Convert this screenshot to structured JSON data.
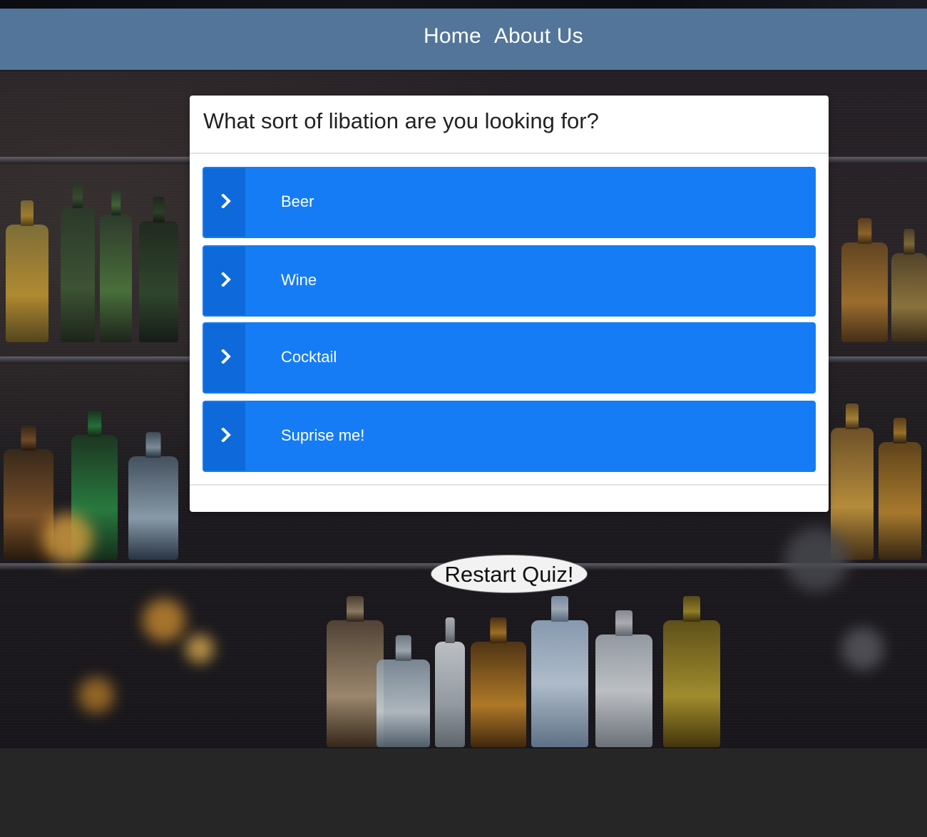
{
  "nav": {
    "links": [
      {
        "label": "Home"
      },
      {
        "label": "About Us"
      }
    ]
  },
  "quiz": {
    "question": "What sort of libation are you looking for?",
    "answers": [
      {
        "label": "Beer",
        "icon": "chevron-right-icon"
      },
      {
        "label": "Wine",
        "icon": "chevron-right-icon"
      },
      {
        "label": "Cocktail",
        "icon": "chevron-right-icon"
      },
      {
        "label": "Suprise me!",
        "icon": "chevron-right-icon"
      }
    ],
    "restart_label": "Restart Quiz!"
  },
  "colors": {
    "navbar": "#527599",
    "answer_button": "#157cf5",
    "answer_icon_box": "#0e6ada",
    "page_background": "#262626"
  }
}
